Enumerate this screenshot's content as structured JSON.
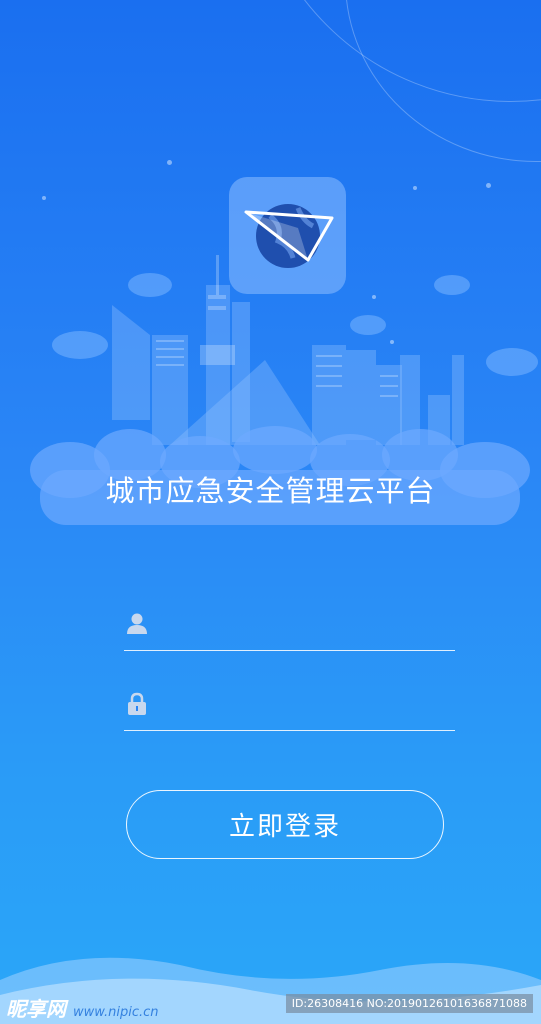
{
  "app": {
    "title": "城市应急安全管理云平台"
  },
  "form": {
    "username_placeholder": "",
    "password_placeholder": "",
    "login_label": "立即登录"
  },
  "icons": {
    "logo": "paper-plane-globe-icon",
    "user": "user-icon",
    "lock": "lock-icon"
  },
  "colors": {
    "background_top": "#1a6ff0",
    "background_bottom": "#2aa7f8",
    "logo_globe": "#1f4fae",
    "text": "#ffffff"
  },
  "watermark": {
    "brand": "昵享网",
    "url": "www.nipic.cn",
    "id": "ID:26308416 NO:20190126101636871088"
  }
}
